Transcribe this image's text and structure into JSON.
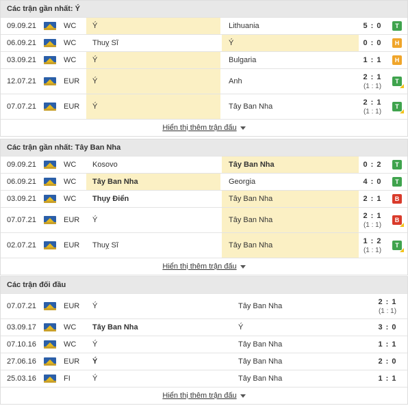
{
  "sections": [
    {
      "title": "Các trận gần nhất: Ý",
      "more_label": "Hiển thị thêm trận đấu",
      "rows": [
        {
          "date": "09.09.21",
          "comp": "WC",
          "home": "Ý",
          "away": "Lithuania",
          "score": "5 : 0",
          "sub": "",
          "result": "T",
          "res_class": "W",
          "hl": "home",
          "bold": ""
        },
        {
          "date": "06.09.21",
          "comp": "WC",
          "home": "Thuỵ Sĩ",
          "away": "Ý",
          "score": "0 : 0",
          "sub": "",
          "result": "H",
          "res_class": "D",
          "hl": "away",
          "bold": ""
        },
        {
          "date": "03.09.21",
          "comp": "WC",
          "home": "Ý",
          "away": "Bulgaria",
          "score": "1 : 1",
          "sub": "",
          "result": "H",
          "res_class": "D",
          "hl": "home",
          "bold": ""
        },
        {
          "date": "12.07.21",
          "comp": "EUR",
          "home": "Ý",
          "away": "Anh",
          "score": "2 : 1",
          "sub": "(1 : 1)",
          "result": "T",
          "res_class": "W",
          "hl": "home",
          "bold": "",
          "corner": true
        },
        {
          "date": "07.07.21",
          "comp": "EUR",
          "home": "Ý",
          "away": "Tây Ban Nha",
          "score": "2 : 1",
          "sub": "(1 : 1)",
          "result": "T",
          "res_class": "W",
          "hl": "home",
          "bold": "",
          "corner": true
        }
      ]
    },
    {
      "title": "Các trận gần nhất: Tây Ban Nha",
      "more_label": "Hiển thị thêm trận đấu",
      "rows": [
        {
          "date": "09.09.21",
          "comp": "WC",
          "home": "Kosovo",
          "away": "Tây Ban Nha",
          "score": "0 : 2",
          "sub": "",
          "result": "T",
          "res_class": "W",
          "hl": "away",
          "bold": "away"
        },
        {
          "date": "06.09.21",
          "comp": "WC",
          "home": "Tây Ban Nha",
          "away": "Georgia",
          "score": "4 : 0",
          "sub": "",
          "result": "T",
          "res_class": "W",
          "hl": "home",
          "bold": "home"
        },
        {
          "date": "03.09.21",
          "comp": "WC",
          "home": "Thụy Điển",
          "away": "Tây Ban Nha",
          "score": "2 : 1",
          "sub": "",
          "result": "B",
          "res_class": "L",
          "hl": "away",
          "bold": "home"
        },
        {
          "date": "07.07.21",
          "comp": "EUR",
          "home": "Ý",
          "away": "Tây Ban Nha",
          "score": "2 : 1",
          "sub": "(1 : 1)",
          "result": "B",
          "res_class": "L",
          "hl": "away",
          "bold": "",
          "corner": true
        },
        {
          "date": "02.07.21",
          "comp": "EUR",
          "home": "Thuỵ Sĩ",
          "away": "Tây Ban Nha",
          "score": "1 : 2",
          "sub": "(1 : 1)",
          "result": "T",
          "res_class": "W",
          "hl": "away",
          "bold": "",
          "corner": true
        }
      ]
    },
    {
      "title": "Các trận đối đầu",
      "more_label": "Hiển thị thêm trận đấu",
      "rows": [
        {
          "date": "07.07.21",
          "comp": "EUR",
          "home": "Ý",
          "away": "Tây Ban Nha",
          "score": "2 : 1",
          "sub": "(1 : 1)",
          "bold": ""
        },
        {
          "date": "03.09.17",
          "comp": "WC",
          "home": "Tây Ban Nha",
          "away": "Ý",
          "score": "3 : 0",
          "sub": "",
          "bold": "home"
        },
        {
          "date": "07.10.16",
          "comp": "WC",
          "home": "Ý",
          "away": "Tây Ban Nha",
          "score": "1 : 1",
          "sub": "",
          "bold": ""
        },
        {
          "date": "27.06.16",
          "comp": "EUR",
          "home": "Ý",
          "away": "Tây Ban Nha",
          "score": "2 : 0",
          "sub": "",
          "bold": "home"
        },
        {
          "date": "25.03.16",
          "comp": "FI",
          "home": "Ý",
          "away": "Tây Ban Nha",
          "score": "1 : 1",
          "sub": "",
          "bold": ""
        }
      ]
    }
  ]
}
